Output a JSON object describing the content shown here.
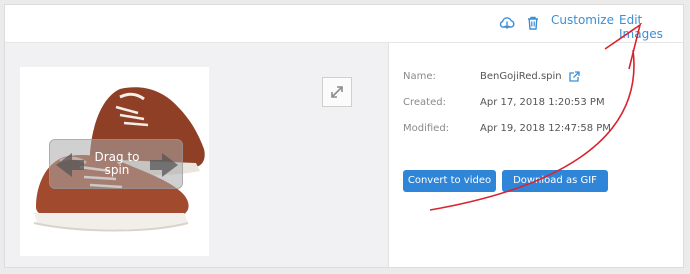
{
  "toolbar": {
    "download_icon": "cloud-download-icon",
    "delete_icon": "trash-icon",
    "customize_label": "Customize",
    "edit_images_label": "Edit Images"
  },
  "viewer": {
    "drag_label": "Drag to spin",
    "fullscreen_icon": "expand-arrows-icon"
  },
  "details": {
    "name_label": "Name:",
    "name_value": "BenGojiRed.spin",
    "created_label": "Created:",
    "created_value": "Apr 17, 2018 1:20:53 PM",
    "modified_label": "Modified:",
    "modified_value": "Apr 19, 2018 12:47:58 PM",
    "open_icon": "external-link-icon"
  },
  "actions": {
    "convert_label": "Convert to video",
    "gif_label": "Download as GIF"
  },
  "colors": {
    "accent": "#2f86d9",
    "annotation_arrow": "#d9232e"
  }
}
